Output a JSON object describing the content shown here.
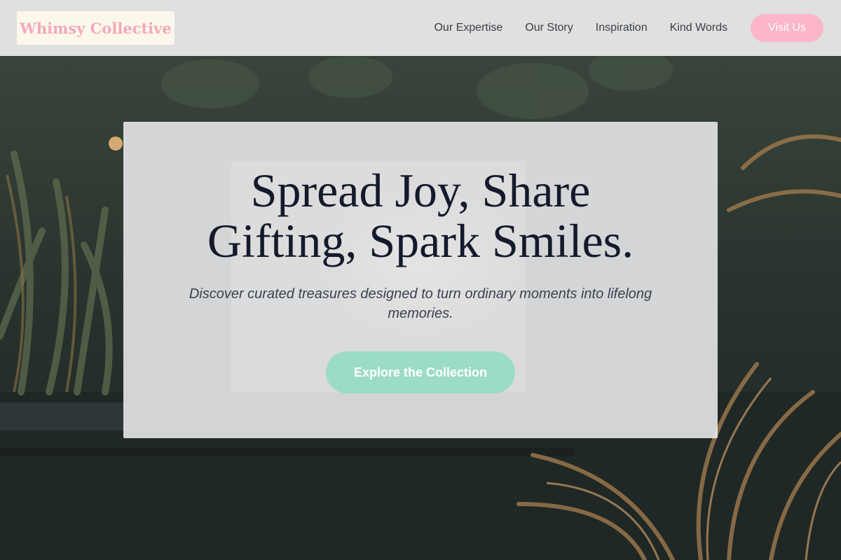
{
  "brand": {
    "name": "Whimsy Collective"
  },
  "nav": {
    "links": [
      {
        "label": "Our Expertise"
      },
      {
        "label": "Our Story"
      },
      {
        "label": "Inspiration"
      },
      {
        "label": "Kind Words"
      }
    ],
    "cta_label": "Visit Us"
  },
  "hero": {
    "headline_line1": "Spread Joy, Share",
    "headline_line2": "Gifting, Spark Smiles.",
    "subtitle": "Discover curated treasures designed to turn ordinary moments into lifelong memories.",
    "cta_label": "Explore the Collection"
  },
  "colors": {
    "brand_pink": "#f3a9b9",
    "visit_button": "#fbb6c8",
    "cta_mint": "#9bdcc8",
    "headline": "#141a2b"
  }
}
